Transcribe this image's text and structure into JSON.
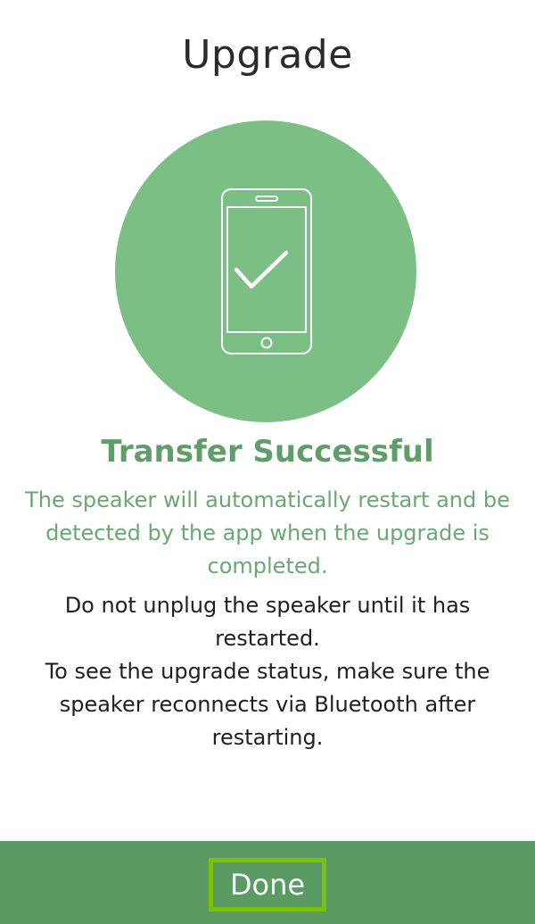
{
  "header": {
    "title": "Upgrade"
  },
  "hero": {
    "icon": "phone-checkmark-icon",
    "circle_color": "#7bbf85"
  },
  "status": {
    "title": "Transfer Successful",
    "detail": "The speaker will automatically restart and be detected by the app when the upgrade is completed."
  },
  "instructions": {
    "unplug_warning": "Do not unplug the speaker until it has restarted.",
    "bluetooth_note": "To see the upgrade status, make sure the speaker reconnects via Bluetooth after restarting."
  },
  "footer": {
    "done_label": "Done",
    "bar_color": "#5a9a63",
    "focus_outline_color": "#7bc00a"
  }
}
